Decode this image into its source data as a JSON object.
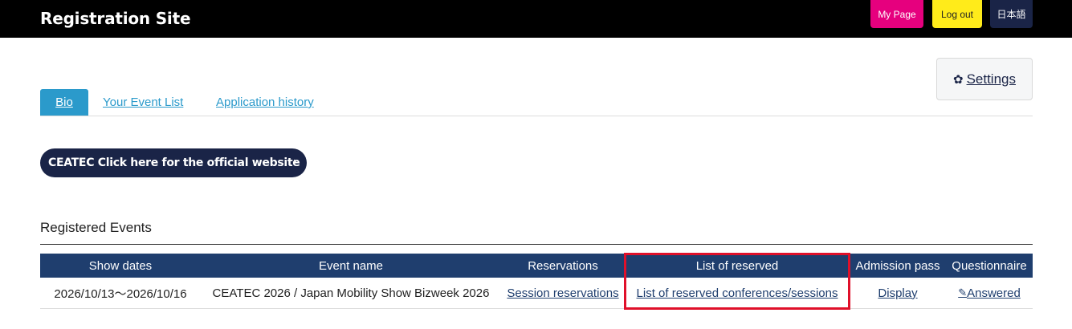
{
  "header": {
    "title": "Registration Site",
    "my_page": "My Page",
    "logout": "Log out",
    "language": "日本語"
  },
  "settings": {
    "label": "Settings",
    "icon": "gear-icon"
  },
  "tabs": [
    {
      "label": "Bio",
      "active": true
    },
    {
      "label": "Your Event List",
      "active": false
    },
    {
      "label": "Application history",
      "active": false
    }
  ],
  "official_link": {
    "label": "CEATEC Click here for the official website",
    "chevron": "›"
  },
  "registered": {
    "title": "Registered Events",
    "columns": [
      "Show dates",
      "Event name",
      "Reservations",
      "List of reserved",
      "Admission pass",
      "Questionnaire"
    ],
    "rows": [
      {
        "dates": "2026/10/13〜2026/10/16",
        "event": "CEATEC 2026 / Japan Mobility Show Bizweek 2026",
        "reservations": "Session reservations",
        "reserved_list": "List of reserved conferences/sessions",
        "admission": "Display",
        "questionnaire": "Answered"
      }
    ]
  },
  "colors": {
    "header_bg": "#000000",
    "accent": "#2b9acb",
    "navy": "#1a2447",
    "table_head": "#1f3e6e",
    "pink": "#e6007e",
    "yellow": "#ffeb1a",
    "highlight": "#e0102a"
  }
}
